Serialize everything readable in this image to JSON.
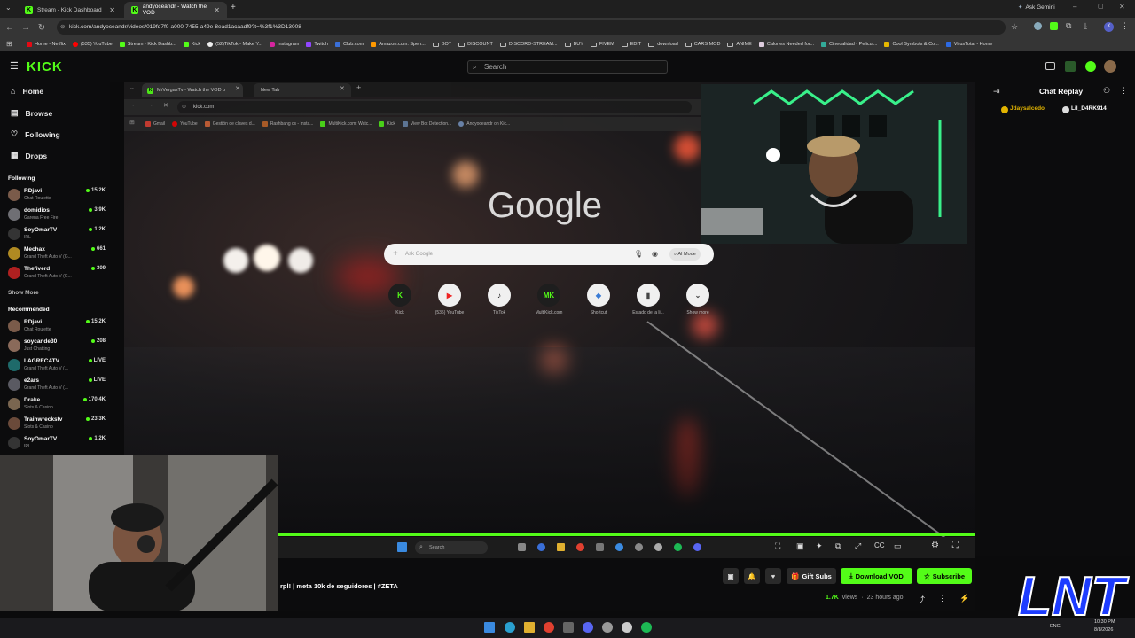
{
  "browser": {
    "tabs": [
      {
        "title": "Stream - Kick Dashboard",
        "active": false
      },
      {
        "title": "andyoceandr - Watch the VOD",
        "active": true
      }
    ],
    "url": "kick.com/andyoceandr/videos/019fd7f0-a000-7455-a49e-8ead1acaadf9?t=%3f1%3D13008",
    "ask_gemini": "Ask Gemini",
    "bookmarks": [
      "Home - Netflix",
      "(535) YouTube",
      "Stream - Kick Dashb...",
      "Kick",
      "(52)TikTok - Make Y...",
      "Instagram",
      "Twitch",
      "Club.com",
      "Amazon.com. Spen...",
      "BOT",
      "DISCOUNT",
      "DISCORD-STREAM...",
      "BUY",
      "FIVEM",
      "EDIT",
      "download",
      "CARS MOD",
      "ANIME",
      "Calories Needed for...",
      "Cinecalidad - Pelicul...",
      "Cool Symbols & Co...",
      "VirusTotal - Home"
    ]
  },
  "header": {
    "logo": "KICK",
    "search_placeholder": "Search"
  },
  "sidebar": {
    "nav": [
      "Home",
      "Browse",
      "Following",
      "Drops"
    ],
    "following_title": "Following",
    "following": [
      {
        "name": "RDjavi",
        "game": "Chat Roulette",
        "viewers": "15.2K",
        "color": "#7a5b4a"
      },
      {
        "name": "domidios",
        "game": "Garena Free Fire",
        "viewers": "3.9K",
        "color": "#6f6f74"
      },
      {
        "name": "SoyOmarTV",
        "game": "IRL",
        "viewers": "1.2K",
        "color": "#343434"
      },
      {
        "name": "Mechax",
        "game": "Grand Theft Auto V (G...",
        "viewers": "661",
        "color": "#b08a22"
      },
      {
        "name": "Thefiverd",
        "game": "Grand Theft Auto V (G...",
        "viewers": "309",
        "color": "#b02020"
      }
    ],
    "show_more": "Show More",
    "recommended_title": "Recommended",
    "recommended": [
      {
        "name": "RDjavi",
        "game": "Chat Roulette",
        "viewers": "15.2K",
        "color": "#7a5b4a"
      },
      {
        "name": "soycande30",
        "game": "Just Chatting",
        "viewers": "208",
        "color": "#8a6a5a"
      },
      {
        "name": "LAGRECATV",
        "game": "Grand Theft Auto V (...",
        "viewers": "LIVE",
        "color": "#1e6a6a"
      },
      {
        "name": "e2ars",
        "game": "Grand Theft Auto V (...",
        "viewers": "LIVE",
        "color": "#5a5a62"
      },
      {
        "name": "Drake",
        "game": "Slots & Casino",
        "viewers": "170.4K",
        "color": "#7a6650"
      },
      {
        "name": "Trainwreckstv",
        "game": "Slots & Casino",
        "viewers": "23.3K",
        "color": "#6a4a3a"
      },
      {
        "name": "SoyOmarTV",
        "game": "IRL",
        "viewers": "1.2K",
        "color": "#343434"
      }
    ]
  },
  "inner_browser": {
    "tabs": [
      "MrVergasTv - Watch the VOD o",
      "New Tab"
    ],
    "url": "kick.com",
    "bookmarks": [
      "Gmail",
      "YouTube",
      "Gestión de claves d...",
      "Rashbang cs - Insta...",
      "MultiKick.com: Watc...",
      "Kick",
      "View Bot Detection...",
      "Andyoceandr on Kic..."
    ],
    "google_logo": "Google",
    "search_placeholder": "Ask Google",
    "ai_mode": "AI Mode",
    "shortcuts": [
      {
        "label": "Kick",
        "glyph": "K",
        "bg": "#1e1e1e",
        "fg": "#53fc18"
      },
      {
        "label": "(535) YouTube",
        "glyph": "▶",
        "bg": "#f0f0f0",
        "fg": "#e22"
      },
      {
        "label": "TikTok",
        "glyph": "♪",
        "bg": "#f0f0f0",
        "fg": "#111"
      },
      {
        "label": "MultiKick.com",
        "glyph": "MK",
        "bg": "#1e1e1e",
        "fg": "#53fc18"
      },
      {
        "label": "Shortcut",
        "glyph": "◆",
        "bg": "#f0f0f0",
        "fg": "#3a7bd5"
      },
      {
        "label": "Estado de la li...",
        "glyph": "▮",
        "bg": "#f0f0f0",
        "fg": "#444"
      },
      {
        "label": "Show more",
        "glyph": "⌄",
        "bg": "#f0f0f0",
        "fg": "#444"
      }
    ],
    "taskbar_search": "Search"
  },
  "chat": {
    "title": "Chat Replay",
    "users": [
      "Jdaysalcedo",
      "Lil_D4RK914"
    ]
  },
  "vod": {
    "stream_title": "rpl! | meta 10k de seguidores | #ZETA",
    "gift_subs": "Gift Subs",
    "download": "Download VOD",
    "subscribe": "Subscribe",
    "views": "1.7K",
    "views_label": "views",
    "time_ago": "23 hours ago"
  },
  "overlay_logo": "LNT",
  "taskbar": {
    "lang": "ENG",
    "time": "10:30 PM",
    "date": "8/8/2026"
  }
}
